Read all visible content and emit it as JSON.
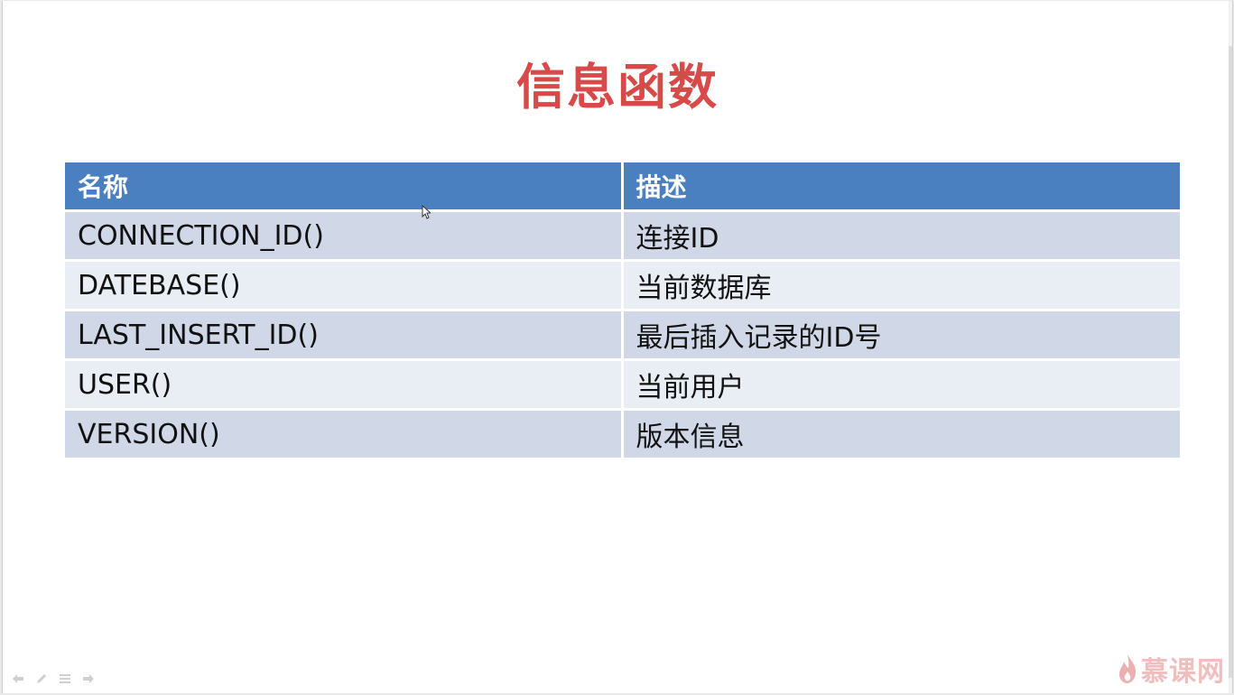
{
  "slide": {
    "title": "信息函数"
  },
  "table": {
    "headers": [
      "名称",
      "描述"
    ],
    "rows": [
      [
        "CONNECTION_ID()",
        "连接ID"
      ],
      [
        "DATEBASE()",
        "当前数据库"
      ],
      [
        "LAST_INSERT_ID()",
        "最后插入记录的ID号"
      ],
      [
        "USER()",
        "当前用户"
      ],
      [
        "VERSION()",
        "版本信息"
      ]
    ]
  },
  "toolbar": {
    "icons": [
      "prev-arrow-icon",
      "pen-icon",
      "menu-icon",
      "next-arrow-icon"
    ]
  },
  "logo": {
    "text": "慕课网"
  },
  "colors": {
    "title": "#d84a4a",
    "header_bg": "#4a7fc0",
    "row_odd": "#d0d8e8",
    "row_even": "#e9edf4"
  }
}
